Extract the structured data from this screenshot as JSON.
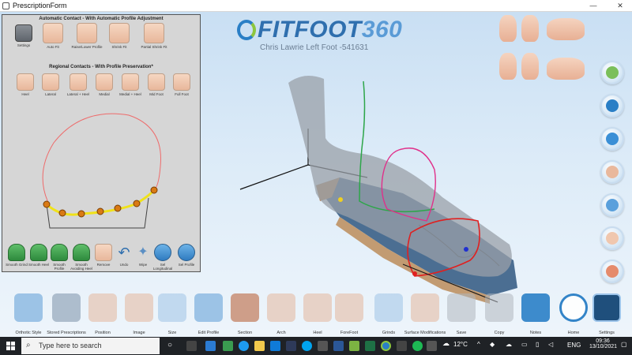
{
  "window": {
    "title": "PrescriptionForm",
    "minimize": "—",
    "close": "✕"
  },
  "header": {
    "logo_prefix": "FITFOOT",
    "logo_number": "360",
    "patient_line": "Chris Lawrie  Left Foot -541631"
  },
  "panel": {
    "auto_title": "Automatic Contact - With Automatic Profile Adjustment",
    "auto_buttons": [
      {
        "label": "Settings",
        "icon": "sliders-icon"
      },
      {
        "label": "Auto Fit",
        "icon": "foot-contact-icon"
      },
      {
        "label": "Raise/Lower Profile",
        "icon": "foot-contact-icon"
      },
      {
        "label": "Shrink Fit",
        "icon": "foot-contact-icon"
      },
      {
        "label": "Partial Shrink Fit",
        "icon": "foot-contact-icon"
      }
    ],
    "regional_title": "Regional Contacts - With Profile Preservation*",
    "regional_buttons": [
      {
        "label": "Heel"
      },
      {
        "label": "Lateral"
      },
      {
        "label": "Lateral + Heel"
      },
      {
        "label": "Medial"
      },
      {
        "label": "Medial + Heel"
      },
      {
        "label": "Mid Foot"
      },
      {
        "label": "Full Foot"
      }
    ],
    "bottom_buttons": [
      {
        "label": "Smooth Grind"
      },
      {
        "label": "Smooth Heel"
      },
      {
        "label": "Smooth Profile"
      },
      {
        "label": "Smooth Avoiding Heel"
      },
      {
        "label": "Remove"
      },
      {
        "label": "Undo"
      },
      {
        "label": "Wipe"
      },
      {
        "label": "Sel Longitudinal"
      },
      {
        "label": "Sel Profile"
      }
    ]
  },
  "toolbar": {
    "tools": [
      {
        "label": "Orthotic Style"
      },
      {
        "label": "Stored Prescriptions"
      },
      {
        "label": "Position"
      },
      {
        "label": "Image"
      },
      {
        "label": "Size"
      },
      {
        "label": "Edit Profile"
      },
      {
        "label": "Section"
      },
      {
        "label": "Arch"
      },
      {
        "label": "Heel"
      },
      {
        "label": "ForeFoot"
      },
      {
        "label": "Grinds"
      },
      {
        "label": "Surface Modifications"
      },
      {
        "label": "Save"
      },
      {
        "label": "Copy"
      },
      {
        "label": "Notes"
      },
      {
        "label": "Home"
      },
      {
        "label": "Settings"
      }
    ]
  },
  "taskbar": {
    "search_placeholder": "Type here to search",
    "weather": "12°C",
    "language": "ENG",
    "time": "09:36",
    "date": "13/10/2021"
  },
  "colors": {
    "accent": "#2a7fc6",
    "brand_green": "#8cc63f",
    "panel_bg": "#d6d6d6",
    "taskbar_bg": "#1f2226"
  }
}
